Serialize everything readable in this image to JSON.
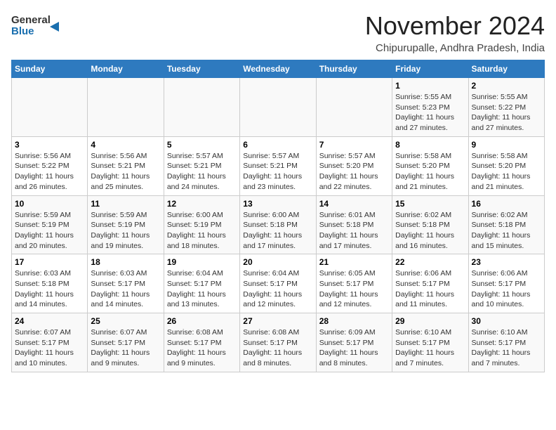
{
  "header": {
    "logo_general": "General",
    "logo_blue": "Blue",
    "month_year": "November 2024",
    "location": "Chipurupalle, Andhra Pradesh, India"
  },
  "weekdays": [
    "Sunday",
    "Monday",
    "Tuesday",
    "Wednesday",
    "Thursday",
    "Friday",
    "Saturday"
  ],
  "weeks": [
    [
      {
        "day": "",
        "info": ""
      },
      {
        "day": "",
        "info": ""
      },
      {
        "day": "",
        "info": ""
      },
      {
        "day": "",
        "info": ""
      },
      {
        "day": "",
        "info": ""
      },
      {
        "day": "1",
        "info": "Sunrise: 5:55 AM\nSunset: 5:23 PM\nDaylight: 11 hours and 27 minutes."
      },
      {
        "day": "2",
        "info": "Sunrise: 5:55 AM\nSunset: 5:22 PM\nDaylight: 11 hours and 27 minutes."
      }
    ],
    [
      {
        "day": "3",
        "info": "Sunrise: 5:56 AM\nSunset: 5:22 PM\nDaylight: 11 hours and 26 minutes."
      },
      {
        "day": "4",
        "info": "Sunrise: 5:56 AM\nSunset: 5:21 PM\nDaylight: 11 hours and 25 minutes."
      },
      {
        "day": "5",
        "info": "Sunrise: 5:57 AM\nSunset: 5:21 PM\nDaylight: 11 hours and 24 minutes."
      },
      {
        "day": "6",
        "info": "Sunrise: 5:57 AM\nSunset: 5:21 PM\nDaylight: 11 hours and 23 minutes."
      },
      {
        "day": "7",
        "info": "Sunrise: 5:57 AM\nSunset: 5:20 PM\nDaylight: 11 hours and 22 minutes."
      },
      {
        "day": "8",
        "info": "Sunrise: 5:58 AM\nSunset: 5:20 PM\nDaylight: 11 hours and 21 minutes."
      },
      {
        "day": "9",
        "info": "Sunrise: 5:58 AM\nSunset: 5:20 PM\nDaylight: 11 hours and 21 minutes."
      }
    ],
    [
      {
        "day": "10",
        "info": "Sunrise: 5:59 AM\nSunset: 5:19 PM\nDaylight: 11 hours and 20 minutes."
      },
      {
        "day": "11",
        "info": "Sunrise: 5:59 AM\nSunset: 5:19 PM\nDaylight: 11 hours and 19 minutes."
      },
      {
        "day": "12",
        "info": "Sunrise: 6:00 AM\nSunset: 5:19 PM\nDaylight: 11 hours and 18 minutes."
      },
      {
        "day": "13",
        "info": "Sunrise: 6:00 AM\nSunset: 5:18 PM\nDaylight: 11 hours and 17 minutes."
      },
      {
        "day": "14",
        "info": "Sunrise: 6:01 AM\nSunset: 5:18 PM\nDaylight: 11 hours and 17 minutes."
      },
      {
        "day": "15",
        "info": "Sunrise: 6:02 AM\nSunset: 5:18 PM\nDaylight: 11 hours and 16 minutes."
      },
      {
        "day": "16",
        "info": "Sunrise: 6:02 AM\nSunset: 5:18 PM\nDaylight: 11 hours and 15 minutes."
      }
    ],
    [
      {
        "day": "17",
        "info": "Sunrise: 6:03 AM\nSunset: 5:18 PM\nDaylight: 11 hours and 14 minutes."
      },
      {
        "day": "18",
        "info": "Sunrise: 6:03 AM\nSunset: 5:17 PM\nDaylight: 11 hours and 14 minutes."
      },
      {
        "day": "19",
        "info": "Sunrise: 6:04 AM\nSunset: 5:17 PM\nDaylight: 11 hours and 13 minutes."
      },
      {
        "day": "20",
        "info": "Sunrise: 6:04 AM\nSunset: 5:17 PM\nDaylight: 11 hours and 12 minutes."
      },
      {
        "day": "21",
        "info": "Sunrise: 6:05 AM\nSunset: 5:17 PM\nDaylight: 11 hours and 12 minutes."
      },
      {
        "day": "22",
        "info": "Sunrise: 6:06 AM\nSunset: 5:17 PM\nDaylight: 11 hours and 11 minutes."
      },
      {
        "day": "23",
        "info": "Sunrise: 6:06 AM\nSunset: 5:17 PM\nDaylight: 11 hours and 10 minutes."
      }
    ],
    [
      {
        "day": "24",
        "info": "Sunrise: 6:07 AM\nSunset: 5:17 PM\nDaylight: 11 hours and 10 minutes."
      },
      {
        "day": "25",
        "info": "Sunrise: 6:07 AM\nSunset: 5:17 PM\nDaylight: 11 hours and 9 minutes."
      },
      {
        "day": "26",
        "info": "Sunrise: 6:08 AM\nSunset: 5:17 PM\nDaylight: 11 hours and 9 minutes."
      },
      {
        "day": "27",
        "info": "Sunrise: 6:08 AM\nSunset: 5:17 PM\nDaylight: 11 hours and 8 minutes."
      },
      {
        "day": "28",
        "info": "Sunrise: 6:09 AM\nSunset: 5:17 PM\nDaylight: 11 hours and 8 minutes."
      },
      {
        "day": "29",
        "info": "Sunrise: 6:10 AM\nSunset: 5:17 PM\nDaylight: 11 hours and 7 minutes."
      },
      {
        "day": "30",
        "info": "Sunrise: 6:10 AM\nSunset: 5:17 PM\nDaylight: 11 hours and 7 minutes."
      }
    ]
  ]
}
